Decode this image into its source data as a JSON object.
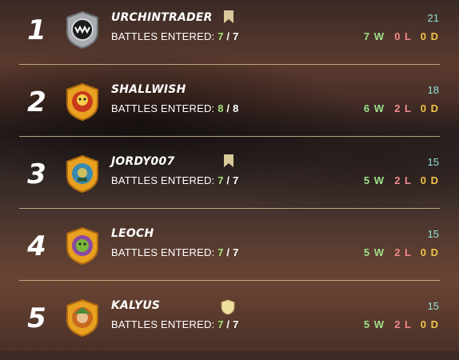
{
  "battles_label": "BATTLES ENTERED:",
  "players": [
    {
      "rank": "1",
      "name": "URCHINTRADER",
      "entered": "7",
      "total": "7",
      "score": "21",
      "wins": "7 W",
      "losses": "0 L",
      "draws": "0 D",
      "badge": "bookmark-icon",
      "avatar_color": "#9aa0a4",
      "avatar": "silver-shield-avatar"
    },
    {
      "rank": "2",
      "name": "SHALLWISH",
      "entered": "8",
      "total": "8",
      "score": "18",
      "wins": "6 W",
      "losses": "2 L",
      "draws": "0 D",
      "badge": "",
      "avatar_color": "#e8a020",
      "avatar": "gold-shield-avatar"
    },
    {
      "rank": "3",
      "name": "JORDY007",
      "entered": "7",
      "total": "7",
      "score": "15",
      "wins": "5 W",
      "losses": "2 L",
      "draws": "0 D",
      "badge": "bookmark-icon",
      "avatar_color": "#e8a020",
      "avatar": "gold-shield-avatar"
    },
    {
      "rank": "4",
      "name": "LEOCH",
      "entered": "7",
      "total": "7",
      "score": "15",
      "wins": "5 W",
      "losses": "2 L",
      "draws": "0 D",
      "badge": "",
      "avatar_color": "#e8a020",
      "avatar": "gold-shield-avatar"
    },
    {
      "rank": "5",
      "name": "KALYUS",
      "entered": "7",
      "total": "7",
      "score": "15",
      "wins": "5 W",
      "losses": "2 L",
      "draws": "0 D",
      "badge": "shield-icon",
      "avatar_color": "#e8a020",
      "avatar": "gold-shield-avatar"
    }
  ],
  "colors": {
    "wins": "#9ee08a",
    "losses": "#f08a8a",
    "draws": "#f2c24a",
    "score": "#8fe0d8",
    "divider": "#d9c39a"
  }
}
